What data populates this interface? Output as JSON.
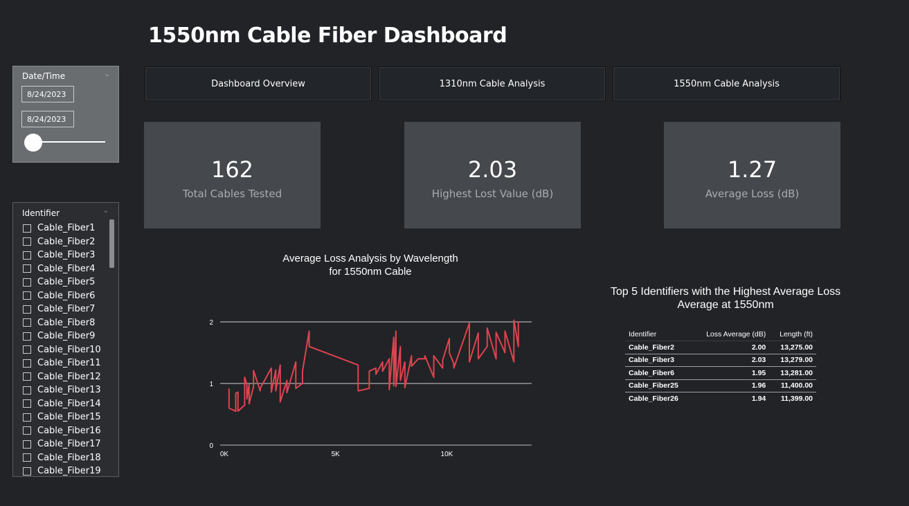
{
  "title": "1550nm Cable Fiber Dashboard",
  "date_slicer": {
    "header": "Date/Time",
    "start": "8/24/2023",
    "end": "8/24/2023"
  },
  "identifier_slicer": {
    "header": "Identifier",
    "items": [
      "Cable_Fiber1",
      "Cable_Fiber2",
      "Cable_Fiber3",
      "Cable_Fiber4",
      "Cable_Fiber5",
      "Cable_Fiber6",
      "Cable_Fiber7",
      "Cable_Fiber8",
      "Cable_Fiber9",
      "Cable_Fiber10",
      "Cable_Fiber11",
      "Cable_Fiber12",
      "Cable_Fiber13",
      "Cable_Fiber14",
      "Cable_Fiber15",
      "Cable_Fiber16",
      "Cable_Fiber17",
      "Cable_Fiber18",
      "Cable_Fiber19"
    ]
  },
  "tabs": [
    {
      "label": "Dashboard Overview"
    },
    {
      "label": "1310nm Cable Analysis"
    },
    {
      "label": "1550nm Cable Analysis"
    }
  ],
  "cards": [
    {
      "value": "162",
      "label": "Total Cables Tested"
    },
    {
      "value": "2.03",
      "label": "Highest Lost Value (dB)"
    },
    {
      "value": "1.27",
      "label": "Average Loss (dB)"
    }
  ],
  "chart": {
    "title_line1": "Average Loss Analysis by Wavelength",
    "title_line2": "for 1550nm Cable"
  },
  "chart_data": {
    "type": "line",
    "xlabel": "",
    "ylabel": "",
    "xlim": [
      0,
      14000
    ],
    "ylim": [
      0,
      2
    ],
    "x_ticks": [
      0,
      5000,
      10000
    ],
    "x_tick_labels": [
      "0K",
      "5K",
      "10K"
    ],
    "y_ticks": [
      0,
      1,
      2
    ],
    "y_tick_labels": [
      "0",
      "1",
      "2"
    ],
    "grid": true,
    "color": "#e0434f",
    "series": [
      {
        "x": [
          400,
          400,
          700,
          700,
          800,
          800,
          1100,
          1100,
          1200,
          1200,
          1300,
          1300,
          1500,
          1500,
          1800,
          1800,
          2300,
          2300,
          2500,
          2500,
          2700,
          2700,
          3000,
          3000,
          3400,
          3400,
          3700,
          3700,
          4000,
          4000,
          6200,
          6200,
          6700,
          6700,
          7000,
          7000,
          7300,
          7300,
          7600,
          7600,
          7800,
          7800,
          7900,
          7900,
          8100,
          8100,
          8300,
          8300,
          8600,
          8600,
          8900,
          8900,
          9200,
          9200,
          9600,
          9600,
          10000,
          10000,
          10300,
          10300,
          10500,
          10500,
          11200,
          11200,
          11600,
          11600,
          12000,
          12000,
          12400,
          12400,
          12800,
          12800,
          13200,
          13200,
          13400,
          13400
        ],
        "y": [
          0.92,
          0.6,
          0.55,
          0.84,
          0.86,
          0.55,
          0.65,
          1.1,
          0.98,
          0.75,
          0.98,
          0.67,
          0.95,
          1.21,
          0.88,
          0.92,
          1.25,
          0.86,
          1.22,
          0.88,
          1.3,
          0.7,
          1.05,
          0.85,
          1.35,
          0.92,
          1.0,
          1.2,
          1.85,
          1.6,
          1.3,
          0.88,
          0.92,
          1.2,
          1.25,
          1.15,
          1.35,
          1.2,
          1.4,
          0.9,
          1.75,
          0.96,
          1.85,
          0.95,
          1.6,
          1.05,
          1.35,
          0.93,
          1.45,
          1.28,
          1.4,
          1.4,
          1.4,
          1.45,
          1.1,
          1.45,
          1.25,
          1.38,
          1.73,
          1.5,
          1.32,
          1.25,
          1.98,
          1.35,
          1.82,
          1.4,
          1.6,
          1.9,
          1.4,
          1.83,
          1.5,
          1.85,
          1.35,
          2.03,
          1.6,
          2.0
        ]
      }
    ]
  },
  "top_table": {
    "title_line1": "Top 5 Identifiers with the Highest Average Loss",
    "title_line2": "Average at 1550nm",
    "columns": [
      "Identifier",
      "Loss Average (dB)",
      "Length (ft)"
    ],
    "rows": [
      [
        "Cable_Fiber2",
        "2.00",
        "13,275.00"
      ],
      [
        "Cable_Fiber3",
        "2.03",
        "13,279.00"
      ],
      [
        "Cable_Fiber6",
        "1.95",
        "13,281.00"
      ],
      [
        "Cable_Fiber25",
        "1.96",
        "11,400.00"
      ],
      [
        "Cable_Fiber26",
        "1.94",
        "11,399.00"
      ]
    ]
  }
}
